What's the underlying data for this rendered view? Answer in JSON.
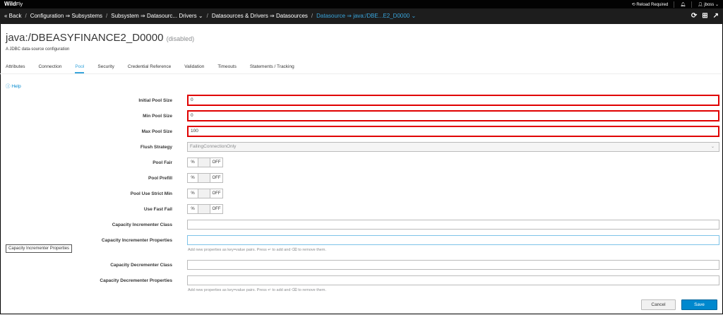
{
  "topbar": {
    "brand_bold": "Wild",
    "brand_rest": "Fly",
    "reload": "Reload Required",
    "user": "jboss"
  },
  "breadcrumb": {
    "back": "« Back",
    "items": [
      "Configuration ⇒ Subsystems",
      "Subsystem ⇒ Datasourc... Drivers ⌄",
      "Datasources & Drivers ⇒ Datasources"
    ],
    "active": "Datasource ⇒ java:/DBE...E2_D0000 ⌄"
  },
  "page": {
    "title": "java:/DBEASYFINANCE2_D0000",
    "status": "(disabled)",
    "subtitle": "A JDBC data-source configuration",
    "help": "Help"
  },
  "tabs": [
    "Attributes",
    "Connection",
    "Pool",
    "Security",
    "Credential Reference",
    "Validation",
    "Timeouts",
    "Statements / Tracking"
  ],
  "form": {
    "initial_pool_size": {
      "label": "Initial Pool Size",
      "value": "0"
    },
    "min_pool_size": {
      "label": "Min Pool Size",
      "value": "0"
    },
    "max_pool_size": {
      "label": "Max Pool Size",
      "value": "100"
    },
    "flush_strategy": {
      "label": "Flush Strategy",
      "value": "FailingConnectionOnly"
    },
    "pool_fair": {
      "label": "Pool Fair",
      "state": "OFF"
    },
    "pool_prefill": {
      "label": "Pool Prefill",
      "state": "OFF"
    },
    "pool_use_strict_min": {
      "label": "Pool Use Strict Min",
      "state": "OFF"
    },
    "use_fast_fail": {
      "label": "Use Fast Fail",
      "state": "OFF"
    },
    "capacity_incrementer_class": {
      "label": "Capacity Incrementer Class",
      "value": ""
    },
    "capacity_incrementer_properties": {
      "label": "Capacity Incrementer Properties",
      "value": ""
    },
    "capacity_decrementer_class": {
      "label": "Capacity Decrementer Class",
      "value": ""
    },
    "capacity_decrementer_properties": {
      "label": "Capacity Decrementer Properties",
      "value": ""
    },
    "properties_hint": "Add new properties as key=value pairs. Press ↵ to add and ⌫ to remove them."
  },
  "switch_on_symbol": "%",
  "tooltip": "Capacity Incrementer Properties",
  "buttons": {
    "cancel": "Cancel",
    "save": "Save"
  },
  "colors": {
    "accent": "#39a5dc",
    "highlight": "#e00000",
    "primary": "#0088ce"
  }
}
